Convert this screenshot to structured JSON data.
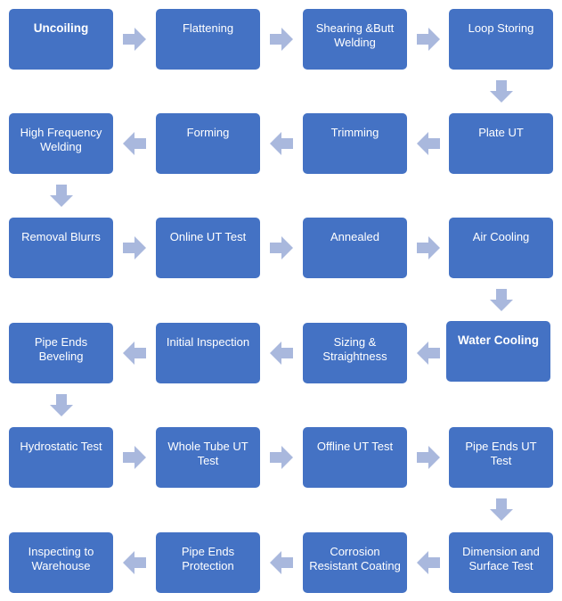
{
  "colors": {
    "box": "#4472C4",
    "arrow": "#A9B8DD",
    "text": "#FFFFFF"
  },
  "steps": [
    {
      "label": "Uncoiling",
      "bold": true
    },
    {
      "label": "Flattening"
    },
    {
      "label": "Shearing &Butt Welding"
    },
    {
      "label": "Loop Storing"
    },
    {
      "label": "Plate UT"
    },
    {
      "label": "Trimming"
    },
    {
      "label": "Forming"
    },
    {
      "label": "High Frequency Welding"
    },
    {
      "label": "Removal Blurrs"
    },
    {
      "label": "Online UT Test"
    },
    {
      "label": "Annealed"
    },
    {
      "label": "Air Cooling"
    },
    {
      "label": "Water Cooling",
      "bold": true
    },
    {
      "label": "Sizing & Straightness"
    },
    {
      "label": "Initial Inspection"
    },
    {
      "label": "Pipe Ends Beveling"
    },
    {
      "label": "Hydrostatic Test"
    },
    {
      "label": "Whole Tube UT Test"
    },
    {
      "label": "Offline UT Test"
    },
    {
      "label": "Pipe Ends UT Test"
    },
    {
      "label": "Dimension and Surface Test"
    },
    {
      "label": "Corrosion Resistant Coating"
    },
    {
      "label": "Pipe Ends Protection"
    },
    {
      "label": "Inspecting to Warehouse"
    }
  ]
}
